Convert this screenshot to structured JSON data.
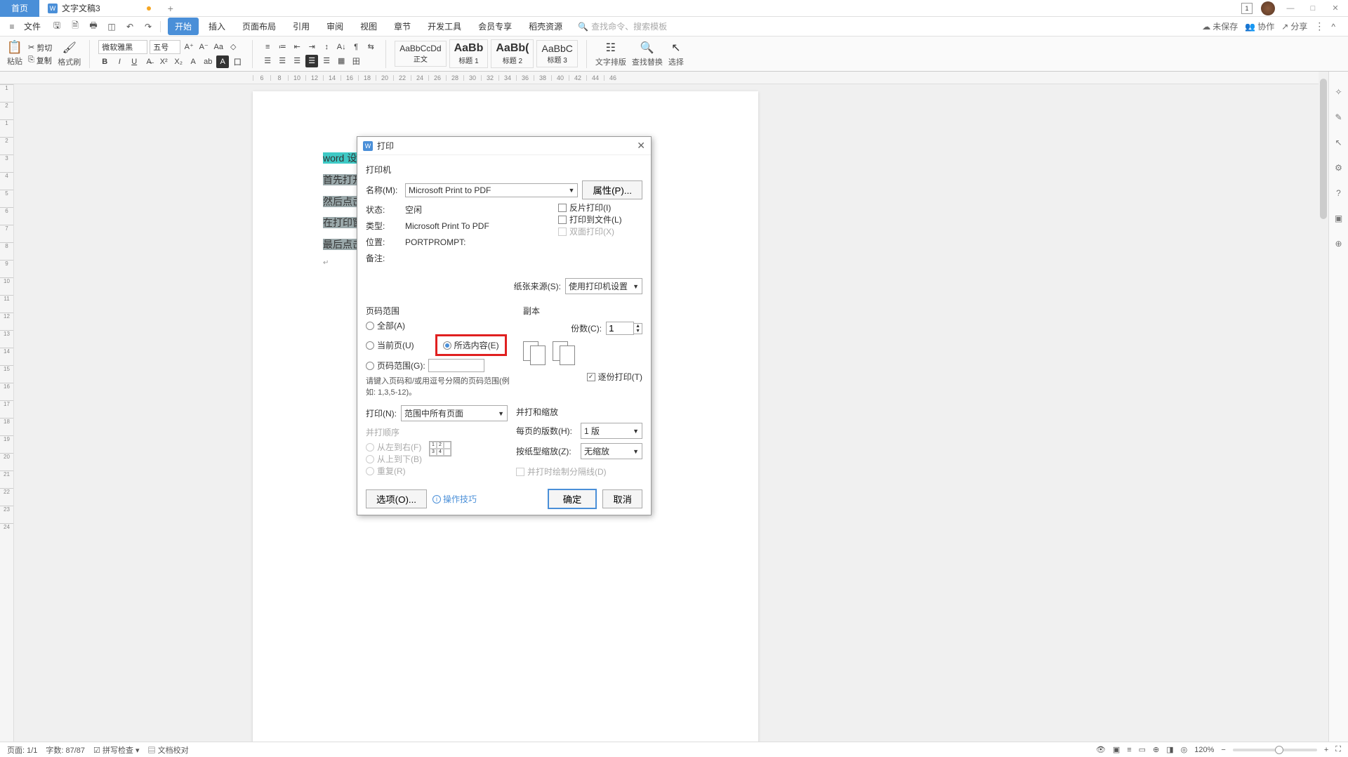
{
  "titlebar": {
    "home_tab": "首页",
    "doc_tab": "文字文稿3",
    "icon_num": "1"
  },
  "menubar": {
    "file": "文件",
    "tabs": [
      "开始",
      "插入",
      "页面布局",
      "引用",
      "审阅",
      "视图",
      "章节",
      "开发工具",
      "会员专享",
      "稻壳资源"
    ],
    "search_placeholder": "查找命令、搜索模板",
    "unsaved": "未保存",
    "collab": "协作",
    "share": "分享"
  },
  "ribbon": {
    "paste": "粘贴",
    "cut": "剪切",
    "copy": "复制",
    "format_brush": "格式刷",
    "font_name": "微软雅黑",
    "font_size": "五号",
    "style_body_sample": "AaBbCcDd",
    "style_body": "正文",
    "style_h1_sample": "AaBb",
    "style_h1": "标题 1",
    "style_h2_sample": "AaBb(",
    "style_h2": "标题 2",
    "style_h3_sample": "AaBbC",
    "style_h3": "标题 3",
    "layout": "文字排版",
    "find": "查找替换",
    "select": "选择"
  },
  "document": {
    "line1": "word 设",
    "line2": "首先打开",
    "line3": "然后点击",
    "line4": "在打印窗",
    "line5": "最后点击"
  },
  "dialog": {
    "title": "打印",
    "printer_section": "打印机",
    "name_label": "名称(M):",
    "name_value": "Microsoft Print to PDF",
    "properties_btn": "属性(P)...",
    "status_label": "状态:",
    "status_value": "空闲",
    "type_label": "类型:",
    "type_value": "Microsoft Print To PDF",
    "location_label": "位置:",
    "location_value": "PORTPROMPT:",
    "comment_label": "备注:",
    "reverse_print": "反片打印(I)",
    "print_to_file": "打印到文件(L)",
    "duplex": "双面打印(X)",
    "paper_source_label": "纸张来源(S):",
    "paper_source_value": "使用打印机设置",
    "page_range_section": "页码范围",
    "range_all": "全部(A)",
    "range_current": "当前页(U)",
    "range_selection": "所选内容(E)",
    "range_pages": "页码范围(G):",
    "range_hint": "请键入页码和/或用逗号分隔的页码范围(例如: 1,3,5-12)。",
    "copies_section": "副本",
    "copies_label": "份数(C):",
    "copies_value": "1",
    "collate": "逐份打印(T)",
    "print_what_label": "打印(N):",
    "print_what_value": "范围中所有页面",
    "order_section": "并打顺序",
    "order_lr": "从左到右(F)",
    "order_tb": "从上到下(B)",
    "order_repeat": "重复(R)",
    "scale_section": "并打和缩放",
    "pages_per_sheet_label": "每页的版数(H):",
    "pages_per_sheet_value": "1 版",
    "scale_to_label": "按纸型缩放(Z):",
    "scale_to_value": "无缩放",
    "draw_lines": "并打时绘制分隔线(D)",
    "options_btn": "选项(O)...",
    "tips_link": "操作技巧",
    "ok_btn": "确定",
    "cancel_btn": "取消"
  },
  "statusbar": {
    "page": "页面: 1/1",
    "words": "字数: 87/87",
    "spellcheck": "拼写检查",
    "proofread": "文档校对",
    "zoom": "120%"
  }
}
